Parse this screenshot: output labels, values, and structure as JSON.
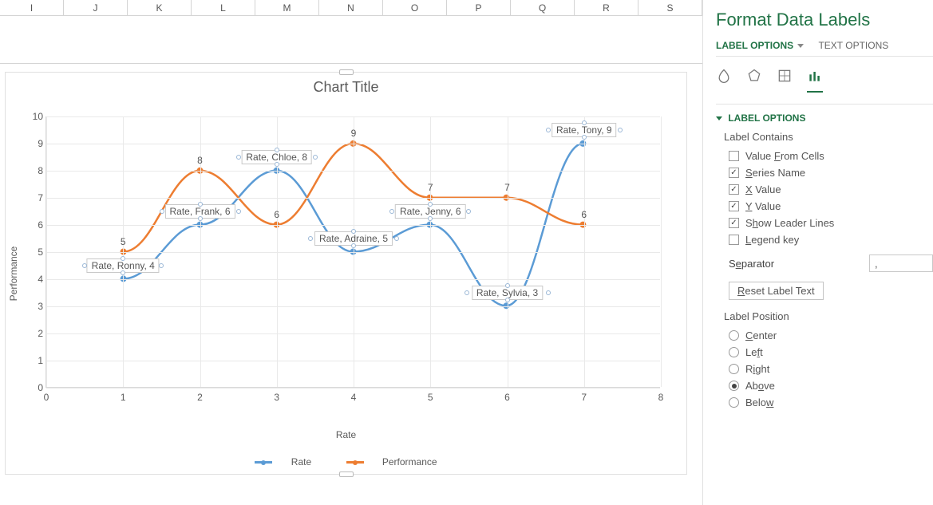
{
  "columns": [
    "I",
    "J",
    "K",
    "L",
    "M",
    "N",
    "O",
    "P",
    "Q",
    "R",
    "S"
  ],
  "chart": {
    "title": "Chart Title",
    "xlabel": "Rate",
    "ylabel": "Performance",
    "legend": {
      "series1": "Rate",
      "series2": "Performance"
    },
    "selected_series": "Rate"
  },
  "chart_data": {
    "type": "line",
    "x": [
      1,
      2,
      3,
      4,
      5,
      6,
      7
    ],
    "names": [
      "Ronny",
      "Frank",
      "Chloe",
      "Adraine",
      "Jenny",
      "Sylvia",
      "Tony"
    ],
    "series": [
      {
        "name": "Rate",
        "color": "#5b9bd5",
        "values": [
          4,
          6,
          8,
          5,
          6,
          3,
          9
        ]
      },
      {
        "name": "Performance",
        "color": "#ed7d31",
        "values": [
          5,
          8,
          6,
          9,
          7,
          7,
          6
        ]
      }
    ],
    "ylim": [
      0,
      10
    ],
    "xlim": [
      0,
      8
    ],
    "datalabels_rate": [
      "Rate, Ronny, 4",
      "Rate, Frank, 6",
      "Rate, Chloe, 8",
      "Rate, Adraine, 5",
      "Rate, Jenny, 6",
      "Rate, Sylvia, 3",
      "Rate, Tony, 9"
    ],
    "datalabels_perf": [
      "5",
      "8",
      "6",
      "9",
      "7",
      "7",
      "6"
    ]
  },
  "panel": {
    "title": "Format Data Labels",
    "tabs": {
      "label_options": "LABEL OPTIONS",
      "text_options": "TEXT OPTIONS"
    },
    "section": "LABEL OPTIONS",
    "label_contains": "Label Contains",
    "options": {
      "value_from_cells": "Value From Cells",
      "series_name": "Series Name",
      "x_value": "X Value",
      "y_value": "Y Value",
      "show_leader": "Show Leader Lines",
      "legend_key": "Legend key"
    },
    "checks": {
      "value_from_cells": false,
      "series_name": true,
      "x_value": true,
      "y_value": true,
      "show_leader": true,
      "legend_key": false
    },
    "separator_label": "Separator",
    "separator_value": ",",
    "reset_label": "Reset Label Text",
    "label_position": "Label Position",
    "positions": {
      "center": "Center",
      "left": "Left",
      "right": "Right",
      "above": "Above",
      "below": "Below"
    },
    "position_selected": "above"
  }
}
